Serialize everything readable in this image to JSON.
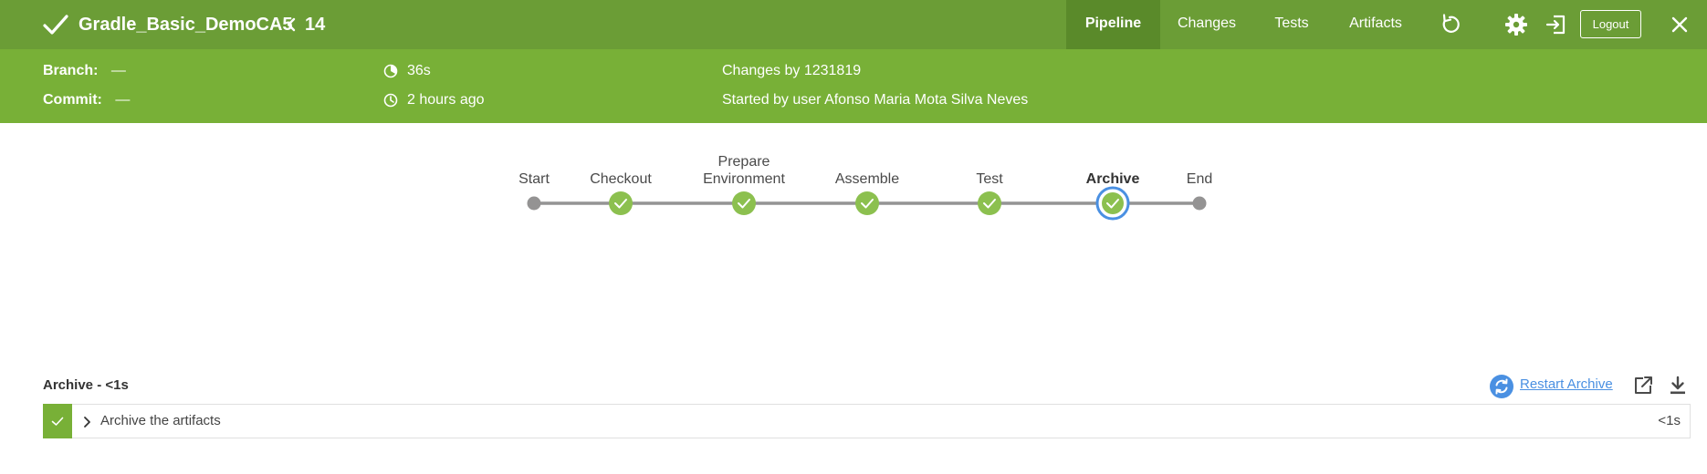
{
  "header": {
    "job_name": "Gradle_Basic_DemoCA5",
    "run_number": "14",
    "status_icon": "check-icon",
    "tabs": [
      {
        "label": "Pipeline",
        "active": true
      },
      {
        "label": "Changes",
        "active": false
      },
      {
        "label": "Tests",
        "active": false
      },
      {
        "label": "Artifacts",
        "active": false
      }
    ],
    "logout_label": "Logout",
    "icons": [
      "replay-icon",
      "gear-icon",
      "exit-icon",
      "close-icon"
    ]
  },
  "info": {
    "branch_label": "Branch:",
    "branch_value": "—",
    "commit_label": "Commit:",
    "commit_value": "—",
    "duration": "36s",
    "time_ago": "2 hours ago",
    "changes_by": "Changes by 1231819",
    "started_by": "Started by user Afonso Maria Mota Silva Neves"
  },
  "pipeline": {
    "stages": [
      {
        "label": "Start",
        "status": "node"
      },
      {
        "label": "Checkout",
        "status": "success"
      },
      {
        "label": "Prepare Environment",
        "status": "success"
      },
      {
        "label": "Assemble",
        "status": "success"
      },
      {
        "label": "Test",
        "status": "success"
      },
      {
        "label": "Archive",
        "status": "success",
        "selected": true
      },
      {
        "label": "End",
        "status": "node"
      }
    ]
  },
  "step_panel": {
    "title": "Archive - <1s",
    "restart_label": "Restart Archive",
    "steps": [
      {
        "label": "Archive the artifacts",
        "duration": "<1s",
        "status": "success"
      }
    ]
  },
  "colors": {
    "header_bg": "#6b9d36",
    "info_bg": "#78b037",
    "success": "#8cc04f",
    "selected_ring": "#4a90e2",
    "link": "#4a90e2",
    "connector": "#949393"
  }
}
